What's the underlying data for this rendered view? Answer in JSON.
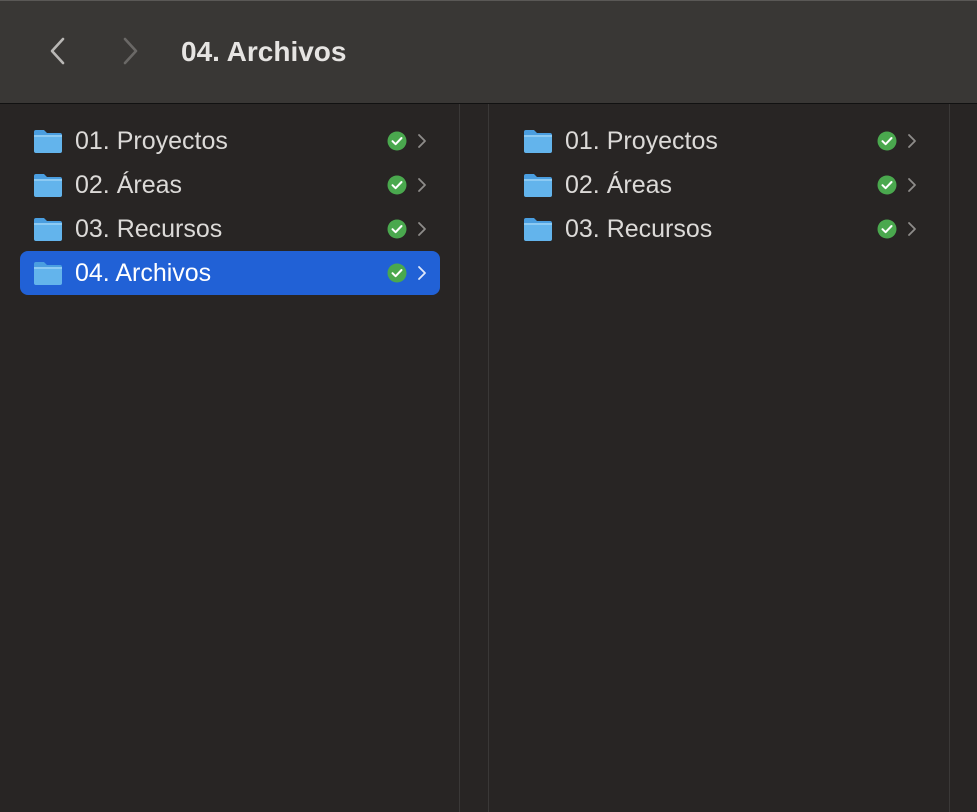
{
  "toolbar": {
    "title": "04. Archivos",
    "back_icon": "chevron-left-icon",
    "forward_icon": "chevron-right-icon"
  },
  "columns": [
    {
      "items": [
        {
          "label": "01. Proyectos",
          "icon": "folder-icon",
          "status": "synced-check-icon",
          "selected": false
        },
        {
          "label": "02. Áreas",
          "icon": "folder-icon",
          "status": "synced-check-icon",
          "selected": false
        },
        {
          "label": "03. Recursos",
          "icon": "folder-icon",
          "status": "synced-check-icon",
          "selected": false
        },
        {
          "label": "04. Archivos",
          "icon": "folder-icon",
          "status": "synced-check-icon",
          "selected": true
        }
      ]
    },
    {
      "items": [
        {
          "label": "01. Proyectos",
          "icon": "folder-icon",
          "status": "synced-check-icon",
          "selected": false
        },
        {
          "label": "02. Áreas",
          "icon": "folder-icon",
          "status": "synced-check-icon",
          "selected": false
        },
        {
          "label": "03. Recursos",
          "icon": "folder-icon",
          "status": "synced-check-icon",
          "selected": false
        }
      ]
    }
  ],
  "colors": {
    "selection": "#2161d6",
    "folder": "#5fb1ea",
    "status_check": "#4caf50",
    "background": "#282524",
    "toolbar": "#393735"
  }
}
